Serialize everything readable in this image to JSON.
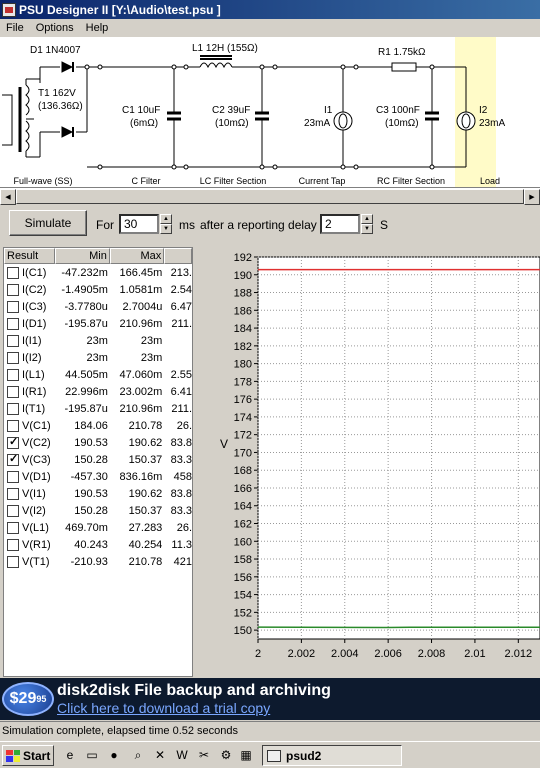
{
  "window": {
    "title": "PSU Designer II  [Y:\\Audio\\test.psu ]"
  },
  "menu": [
    "File",
    "Options",
    "Help"
  ],
  "schematic": {
    "labels": {
      "d1": "D1 1N4007",
      "l1": "L1 12H (155Ω)",
      "r1": "R1 1.75kΩ",
      "t1a": "T1 162V",
      "t1b": "(136.36Ω)",
      "c1a": "C1 10uF",
      "c1b": "(6mΩ)",
      "c2a": "C2 39uF",
      "c2b": "(10mΩ)",
      "i1a": "I1",
      "i1b": "23mA",
      "c3a": "C3 100nF",
      "c3b": "(10mΩ)",
      "i2a": "I2",
      "i2b": "23mA"
    },
    "sections": [
      "Full-wave (SS)",
      "C Filter",
      "LC Filter Section",
      "Current Tap",
      "RC Filter Section",
      "Load"
    ],
    "load_highlight_color": "#fffbc8"
  },
  "toolbar": {
    "simulate": "Simulate",
    "for_label": "For",
    "duration": "30",
    "ms_label": "ms",
    "delay_label": "after a reporting delay of",
    "delay": "2",
    "s_label": "S"
  },
  "results": {
    "headers": [
      "Result",
      "Min",
      "Max",
      ""
    ],
    "rows": [
      {
        "name": "I(C1)",
        "min": "-47.232m",
        "max": "166.45m",
        "extra": "213.",
        "checked": false
      },
      {
        "name": "I(C2)",
        "min": "-1.4905m",
        "max": "1.0581m",
        "extra": "2.54",
        "checked": false
      },
      {
        "name": "I(C3)",
        "min": "-3.7780u",
        "max": "2.7004u",
        "extra": "6.47",
        "checked": false
      },
      {
        "name": "I(D1)",
        "min": "-195.87u",
        "max": "210.96m",
        "extra": "211.",
        "checked": false
      },
      {
        "name": "I(I1)",
        "min": "23m",
        "max": "23m",
        "extra": "",
        "checked": false
      },
      {
        "name": "I(I2)",
        "min": "23m",
        "max": "23m",
        "extra": "",
        "checked": false
      },
      {
        "name": "I(L1)",
        "min": "44.505m",
        "max": "47.060m",
        "extra": "2.55",
        "checked": false
      },
      {
        "name": "I(R1)",
        "min": "22.996m",
        "max": "23.002m",
        "extra": "6.41",
        "checked": false
      },
      {
        "name": "I(T1)",
        "min": "-195.87u",
        "max": "210.96m",
        "extra": "211.",
        "checked": false
      },
      {
        "name": "V(C1)",
        "min": "184.06",
        "max": "210.78",
        "extra": "26.",
        "checked": false
      },
      {
        "name": "V(C2)",
        "min": "190.53",
        "max": "190.62",
        "extra": "83.8",
        "checked": true
      },
      {
        "name": "V(C3)",
        "min": "150.28",
        "max": "150.37",
        "extra": "83.3",
        "checked": true
      },
      {
        "name": "V(D1)",
        "min": "-457.30",
        "max": "836.16m",
        "extra": "458",
        "checked": false
      },
      {
        "name": "V(I1)",
        "min": "190.53",
        "max": "190.62",
        "extra": "83.8",
        "checked": false
      },
      {
        "name": "V(I2)",
        "min": "150.28",
        "max": "150.37",
        "extra": "83.3",
        "checked": false
      },
      {
        "name": "V(L1)",
        "min": "469.70m",
        "max": "27.283",
        "extra": "26.",
        "checked": false
      },
      {
        "name": "V(R1)",
        "min": "40.243",
        "max": "40.254",
        "extra": "11.3",
        "checked": false
      },
      {
        "name": "V(T1)",
        "min": "-210.93",
        "max": "210.78",
        "extra": "421",
        "checked": false
      }
    ]
  },
  "chart_data": {
    "type": "line",
    "xlabel": "",
    "ylabel": "V",
    "xlim": [
      2,
      2.013
    ],
    "ylim": [
      149,
      192
    ],
    "x_ticks": [
      "2",
      "2.002",
      "2.004",
      "2.006",
      "2.008",
      "2.01",
      "2.012"
    ],
    "y_ticks": [
      "192",
      "190",
      "188",
      "186",
      "184",
      "182",
      "180",
      "178",
      "176",
      "174",
      "172",
      "170",
      "168",
      "166",
      "164",
      "162",
      "160",
      "158",
      "156",
      "154",
      "152",
      "150"
    ],
    "grid": true,
    "series": [
      {
        "color": "#e03030",
        "x": [
          2,
          2.013
        ],
        "y": [
          190.58,
          190.58
        ]
      },
      {
        "color": "#2a8a2a",
        "x": [
          2,
          2.006,
          2.007,
          2.013
        ],
        "y": [
          150.34,
          150.3,
          150.33,
          150.33
        ]
      }
    ]
  },
  "ad": {
    "price": "$29",
    "cents": "95",
    "headline": "disk2disk File backup and archiving",
    "link": "Click here to download a trial copy"
  },
  "status": "Simulation complete, elapsed time 0.52 seconds",
  "taskbar": {
    "start": "Start",
    "task": "psud2"
  }
}
